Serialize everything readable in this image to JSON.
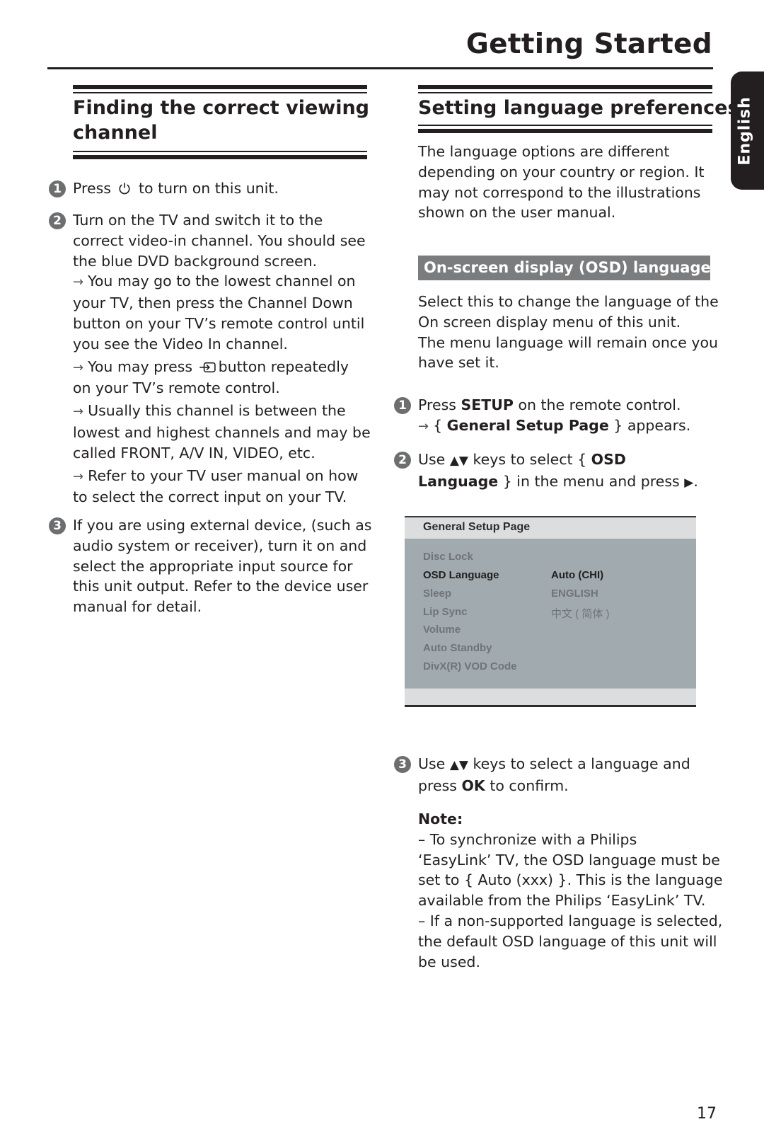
{
  "header": {
    "title": "Getting Started",
    "language_tab": "English",
    "page_number": "17"
  },
  "left_section": {
    "title_line1": "Finding the correct viewing",
    "title_line2": "channel",
    "steps": [
      {
        "number": "1",
        "lines": [
          "Press",
          "to turn on this unit."
        ]
      },
      {
        "number": "2",
        "lines": [
          "Turn on the TV and switch it to the",
          "correct video-in channel. You should see",
          "the blue DVD background screen.",
          "You may go to the lowest channel on",
          "your TV, then press the Channel Down",
          "button on your TV’s remote control until",
          "you see the Video In channel.",
          "You may press",
          "button repeatedly",
          "on your TV’s remote control.",
          "Usually this channel is between the",
          "lowest and highest channels and may be",
          "called FRONT, A/V IN, VIDEO, etc.",
          "Refer to your TV user manual on how",
          "to select the correct input on your TV."
        ]
      },
      {
        "number": "3",
        "lines": [
          "If you are using external device, (such as",
          "audio system or receiver), turn it on and",
          "select the appropriate input source for",
          "this unit output. Refer to the device user",
          "manual for detail."
        ]
      }
    ]
  },
  "right_section": {
    "title": "Setting language preferences",
    "intro": [
      "The language options are different",
      "depending on your country or region. It",
      "may not correspond to the illustrations",
      "shown on the user manual."
    ],
    "osd_heading": "On-screen display (OSD) language",
    "osd_desc": [
      "Select this to change the language of the",
      "On screen display menu of this unit.",
      "The menu language will remain once you",
      "have set it."
    ],
    "step1": {
      "number": "1",
      "pre": "Press ",
      "bold": "SETUP",
      "post": " on the remote control.",
      "result_pre": "{ ",
      "result_bold": "General Setup Page",
      "result_post": " } appears."
    },
    "step2": {
      "number": "2",
      "pre": "Use ",
      "keys": "▲▼",
      "mid": " keys to select { ",
      "bold1": "OSD",
      "bold2": "Language",
      "post": " } in the menu and press ",
      "end_key": "▶",
      "end": "."
    },
    "menu": {
      "title": "General Setup Page",
      "items": [
        "Disc Lock",
        "OSD Language",
        "Sleep",
        "Lip Sync",
        "Volume",
        "Auto Standby",
        "DivX(R) VOD Code"
      ],
      "selected_item": "OSD Language",
      "options": [
        "Auto (CHI)",
        "ENGLISH",
        "中文 ( 简体 )"
      ],
      "selected_option": "Auto (CHI)"
    },
    "step3": {
      "number": "3",
      "pre": "Use ",
      "keys": "▲▼",
      "mid": " keys to select a language and",
      "line2_pre": "press ",
      "line2_bold": "OK",
      "line2_post": " to confirm."
    },
    "note": {
      "label": "Note:",
      "lines": [
        "–  To synchronize with a Philips",
        "‘EasyLink’ TV, the OSD language must be",
        "set to { Auto (xxx) }. This is the language",
        "available from the Philips ‘EasyLink’ TV.",
        "–  If a non-supported language is selected,",
        "the default OSD language of this unit will",
        "be used."
      ]
    }
  },
  "icons": {
    "power": "power-icon",
    "input_source": "input-source-icon",
    "arrow": "→"
  }
}
